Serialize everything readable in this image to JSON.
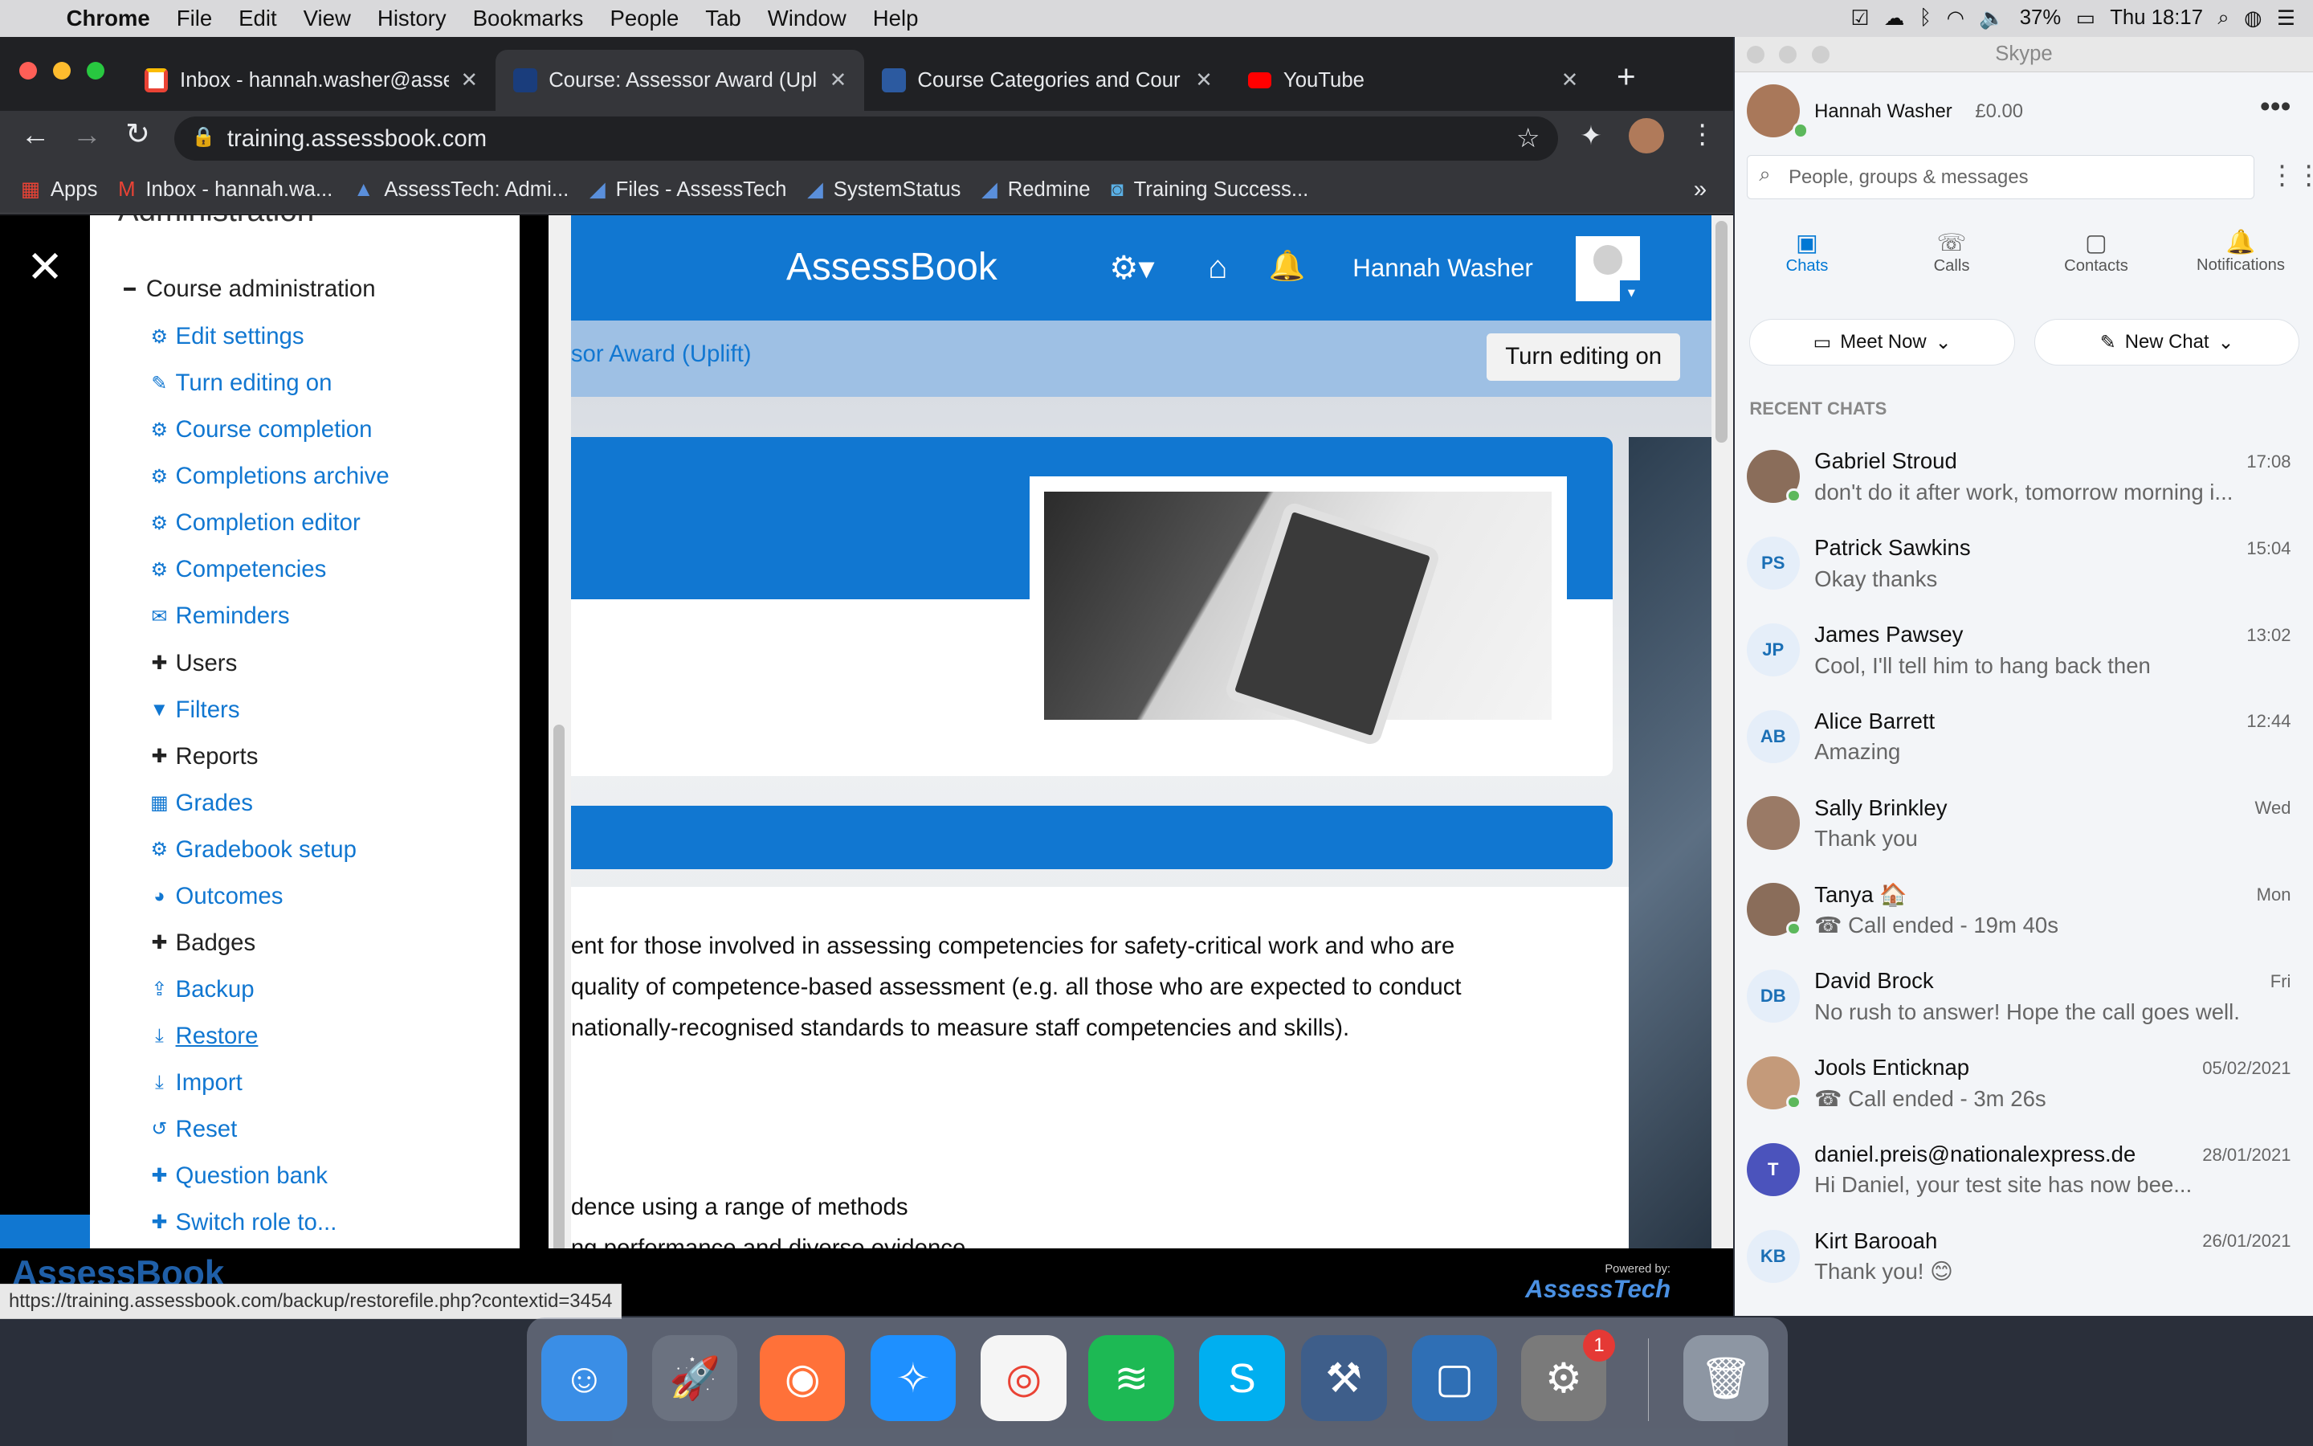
{
  "menubar": {
    "app": "Chrome",
    "items": [
      "File",
      "Edit",
      "View",
      "History",
      "Bookmarks",
      "People",
      "Tab",
      "Window",
      "Help"
    ],
    "battery": "37%",
    "clock": "Thu 18:17"
  },
  "browser": {
    "tabs": [
      {
        "title": "Inbox - hannah.washer@asse",
        "favicon": "gmail-icon",
        "color": "#ea4335"
      },
      {
        "title": "Course: Assessor Award (Upl",
        "favicon": "assesstech-icon",
        "color": "#1a3d7c"
      },
      {
        "title": "Course Categories and Cour",
        "favicon": "assessbook-icon",
        "color": "#1a3d7c"
      },
      {
        "title": "YouTube",
        "favicon": "youtube-icon",
        "color": "#ff0000"
      }
    ],
    "url": "training.assessbook.com",
    "bookmarks": [
      {
        "label": "Apps"
      },
      {
        "label": "Inbox - hannah.wa..."
      },
      {
        "label": "AssessTech: Admi..."
      },
      {
        "label": "Files - AssessTech"
      },
      {
        "label": "SystemStatus"
      },
      {
        "label": "Redmine"
      },
      {
        "label": "Training Success..."
      }
    ],
    "status_url": "https://training.assessbook.com/backup/restorefile.php?contextid=3454"
  },
  "drawer": {
    "title": "Administration",
    "section": "Course administration",
    "items": [
      {
        "label": "Edit settings",
        "icon": "gear-icon",
        "glyph": "⚙",
        "dark": false
      },
      {
        "label": "Turn editing on",
        "icon": "pencil-icon",
        "glyph": "✎",
        "dark": false
      },
      {
        "label": "Course completion",
        "icon": "gear-icon",
        "glyph": "⚙",
        "dark": false
      },
      {
        "label": "Completions archive",
        "icon": "gear-icon",
        "glyph": "⚙",
        "dark": false
      },
      {
        "label": "Completion editor",
        "icon": "gear-icon",
        "glyph": "⚙",
        "dark": false
      },
      {
        "label": "Competencies",
        "icon": "gear-icon",
        "glyph": "⚙",
        "dark": false
      },
      {
        "label": "Reminders",
        "icon": "envelope-icon",
        "glyph": "✉",
        "dark": false
      },
      {
        "label": "Users",
        "icon": "plus-icon",
        "glyph": "✚",
        "dark": true
      },
      {
        "label": "Filters",
        "icon": "filter-icon",
        "glyph": "▼",
        "dark": false
      },
      {
        "label": "Reports",
        "icon": "plus-icon",
        "glyph": "✚",
        "dark": true
      },
      {
        "label": "Grades",
        "icon": "table-icon",
        "glyph": "▦",
        "dark": false
      },
      {
        "label": "Gradebook setup",
        "icon": "gear-icon",
        "glyph": "⚙",
        "dark": false
      },
      {
        "label": "Outcomes",
        "icon": "pie-icon",
        "glyph": "◕",
        "dark": false
      },
      {
        "label": "Badges",
        "icon": "plus-icon",
        "glyph": "✚",
        "dark": true
      },
      {
        "label": "Backup",
        "icon": "upload-icon",
        "glyph": "⇪",
        "dark": false
      },
      {
        "label": "Restore",
        "icon": "download-icon",
        "glyph": "⤓",
        "dark": false
      },
      {
        "label": "Import",
        "icon": "download-icon",
        "glyph": "⤓",
        "dark": false
      },
      {
        "label": "Reset",
        "icon": "reset-icon",
        "glyph": "↺",
        "dark": false
      },
      {
        "label": "Question bank",
        "icon": "plus-icon",
        "glyph": "✚",
        "dark": false
      },
      {
        "label": "Switch role to...",
        "icon": "plus-icon",
        "glyph": "✚",
        "dark": false
      }
    ]
  },
  "site": {
    "brand": "AssessBook",
    "user": "Hannah Washer",
    "breadcrumb": "sor Award (Uplift)",
    "edit_button": "Turn editing on",
    "body_lines": [
      "ent for those involved in assessing competencies for safety-critical work and who are",
      "quality of competence-based assessment (e.g. all those who are expected to conduct",
      "nationally-recognised standards to measure staff competencies and skills)."
    ],
    "list_lines": [
      "dence using a range of methods",
      "ng performance and diverse evidence"
    ],
    "footer_brand_left": "AssessBook",
    "footer_powered": "Powered by:",
    "footer_brand_right": "AssessTech"
  },
  "skype": {
    "window_title": "Skype",
    "profile_name": "Hannah Washer",
    "balance": "£0.00",
    "search_placeholder": "People, groups & messages",
    "nav": [
      {
        "label": "Chats",
        "icon": "chat-icon",
        "glyph": "💬"
      },
      {
        "label": "Calls",
        "icon": "phone-icon",
        "glyph": "☏"
      },
      {
        "label": "Contacts",
        "icon": "contacts-icon",
        "glyph": "▣"
      },
      {
        "label": "Notifications",
        "icon": "bell-icon",
        "glyph": "🔔"
      }
    ],
    "meet_now": "Meet Now",
    "new_chat": "New Chat",
    "recent_label": "RECENT CHATS",
    "chats": [
      {
        "name": "Gabriel Stroud",
        "time": "17:08",
        "msg": "don't do it after work, tomorrow morning i...",
        "initials": "",
        "online": true
      },
      {
        "name": "Patrick Sawkins",
        "time": "15:04",
        "msg": "Okay thanks",
        "initials": "PS",
        "online": false
      },
      {
        "name": "James Pawsey",
        "time": "13:02",
        "msg": "Cool, I'll tell him to hang back then",
        "initials": "JP",
        "online": false
      },
      {
        "name": "Alice Barrett",
        "time": "12:44",
        "msg": "Amazing",
        "initials": "AB",
        "online": false
      },
      {
        "name": "Sally Brinkley",
        "time": "Wed",
        "msg": "Thank you",
        "initials": "",
        "online": false
      },
      {
        "name": "Tanya 🏠",
        "time": "Mon",
        "msg": "☎ Call ended - 19m 40s",
        "initials": "",
        "online": true
      },
      {
        "name": "David Brock",
        "time": "Fri",
        "msg": "No rush to answer! Hope the call goes well.",
        "initials": "DB",
        "online": false
      },
      {
        "name": "Jools Enticknap",
        "time": "05/02/2021",
        "msg": "☎ Call ended - 3m 26s",
        "initials": "",
        "online": true
      },
      {
        "name": "daniel.preis@nationalexpress.de",
        "time": "28/01/2021",
        "msg": "Hi Daniel, your test site has now bee...",
        "initials": "T",
        "online": false
      },
      {
        "name": "Kirt Barooah",
        "time": "26/01/2021",
        "msg": "Thank you! 😊",
        "initials": "KB",
        "online": false
      }
    ]
  },
  "dock": {
    "apps": [
      {
        "name": "finder",
        "color": "#3a8ee6",
        "glyph": "☺"
      },
      {
        "name": "launchpad",
        "color": "#6b7280",
        "glyph": "🚀"
      },
      {
        "name": "firefox",
        "color": "#ff7139",
        "glyph": "◉"
      },
      {
        "name": "safari",
        "color": "#1e90ff",
        "glyph": "✧"
      },
      {
        "name": "chrome",
        "color": "#f5f5f5",
        "glyph": "◎"
      },
      {
        "name": "spotify",
        "color": "#1db954",
        "glyph": "≋"
      },
      {
        "name": "skype",
        "color": "#00aff0",
        "glyph": "S"
      },
      {
        "name": "mysql-workbench",
        "color": "#3e5e8a",
        "glyph": "⚒"
      },
      {
        "name": "brackets",
        "color": "#2f6fb5",
        "glyph": "▢"
      },
      {
        "name": "system-preferences",
        "color": "#7a7a7a",
        "glyph": "⚙"
      },
      {
        "name": "trash",
        "color": "#8d96a3",
        "glyph": "🗑"
      }
    ],
    "badge": "1"
  }
}
